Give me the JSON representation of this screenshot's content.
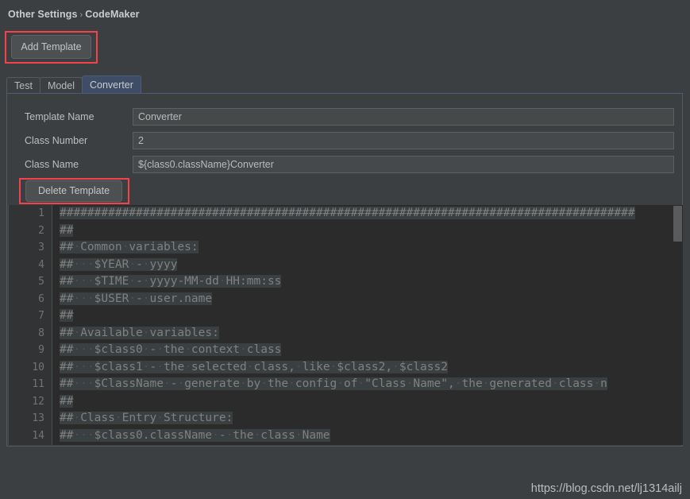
{
  "breadcrumb": {
    "root": "Other Settings",
    "separator": "›",
    "current": "CodeMaker"
  },
  "toolbar": {
    "add_template_label": "Add Template"
  },
  "tabs": [
    {
      "label": "Test",
      "active": false
    },
    {
      "label": "Model",
      "active": false
    },
    {
      "label": "Converter",
      "active": true
    }
  ],
  "form": {
    "rows": [
      {
        "label": "Template Name",
        "value": "Converter"
      },
      {
        "label": "Class Number",
        "value": "2"
      },
      {
        "label": "Class Name",
        "value": "${class0.className}Converter"
      }
    ],
    "delete_template_label": "Delete Template"
  },
  "editor": {
    "line_numbers": [
      "1",
      "2",
      "3",
      "4",
      "5",
      "6",
      "7",
      "8",
      "9",
      "10",
      "11",
      "12",
      "13",
      "14"
    ],
    "lines": [
      "###################################################################################",
      "##",
      "## Common variables:",
      "##   $YEAR - yyyy",
      "##   $TIME - yyyy-MM-dd HH:mm:ss",
      "##   $USER - user.name",
      "##",
      "## Available variables:",
      "##   $class0 - the context class",
      "##   $class1 - the selected class, like $class2, $class2",
      "##   $ClassName - generate by the config of \"Class Name\", the generated class n",
      "##",
      "## Class Entry Structure:",
      "##   $class0.className - the class Name"
    ]
  },
  "watermark": {
    "text": "https://blog.csdn.net/lj1314ailj"
  },
  "colors": {
    "background": "#3c3f41",
    "editor_background": "#2b2b2b",
    "gutter_background": "#313335",
    "accent_tab": "#3f4c66",
    "highlight_border": "#f4414a",
    "text": "#bbbbbb",
    "code_text": "#808080"
  }
}
